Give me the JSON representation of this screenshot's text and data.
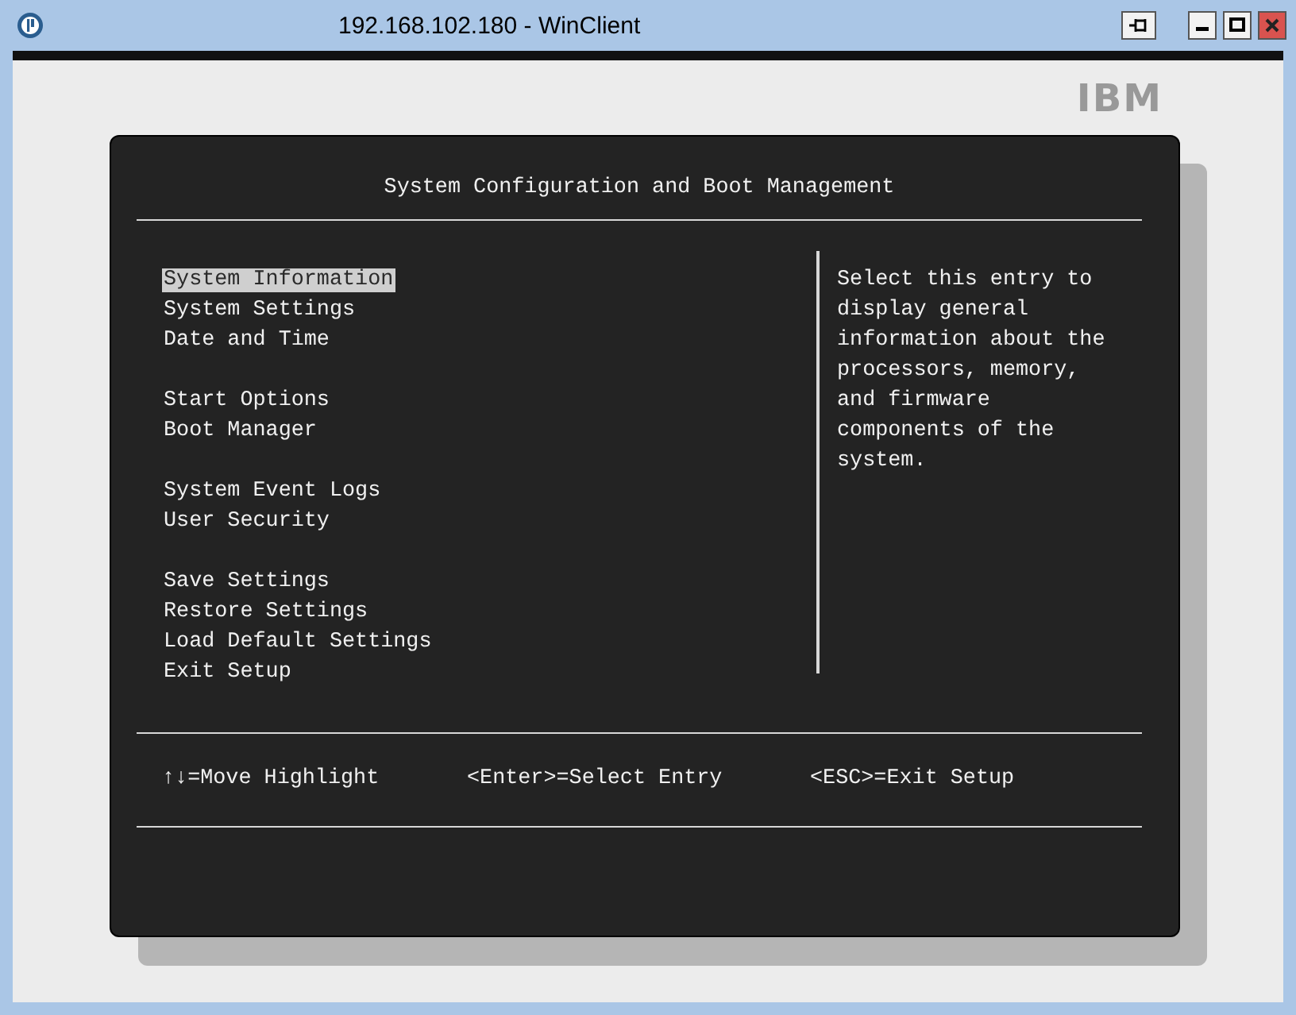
{
  "window": {
    "title": "192.168.102.180 - WinClient"
  },
  "logo": "IBM",
  "screen_title": "System Configuration and Boot Management",
  "menu_groups": [
    [
      {
        "label": "System Information",
        "selected": true
      },
      {
        "label": "System Settings",
        "selected": false
      },
      {
        "label": "Date and Time",
        "selected": false
      }
    ],
    [
      {
        "label": "Start Options",
        "selected": false
      },
      {
        "label": "Boot Manager",
        "selected": false
      }
    ],
    [
      {
        "label": "System Event Logs",
        "selected": false
      },
      {
        "label": "User Security",
        "selected": false
      }
    ],
    [
      {
        "label": "Save Settings",
        "selected": false
      },
      {
        "label": "Restore Settings",
        "selected": false
      },
      {
        "label": "Load Default Settings",
        "selected": false
      },
      {
        "label": "Exit Setup",
        "selected": false
      }
    ]
  ],
  "help_lines": [
    "Select this entry to",
    "display general",
    "information about the",
    "processors, memory,",
    "and firmware",
    "components of the",
    "system."
  ],
  "footer_hints": [
    "↑↓=Move Highlight",
    "<Enter>=Select Entry",
    "<ESC>=Exit Setup"
  ]
}
